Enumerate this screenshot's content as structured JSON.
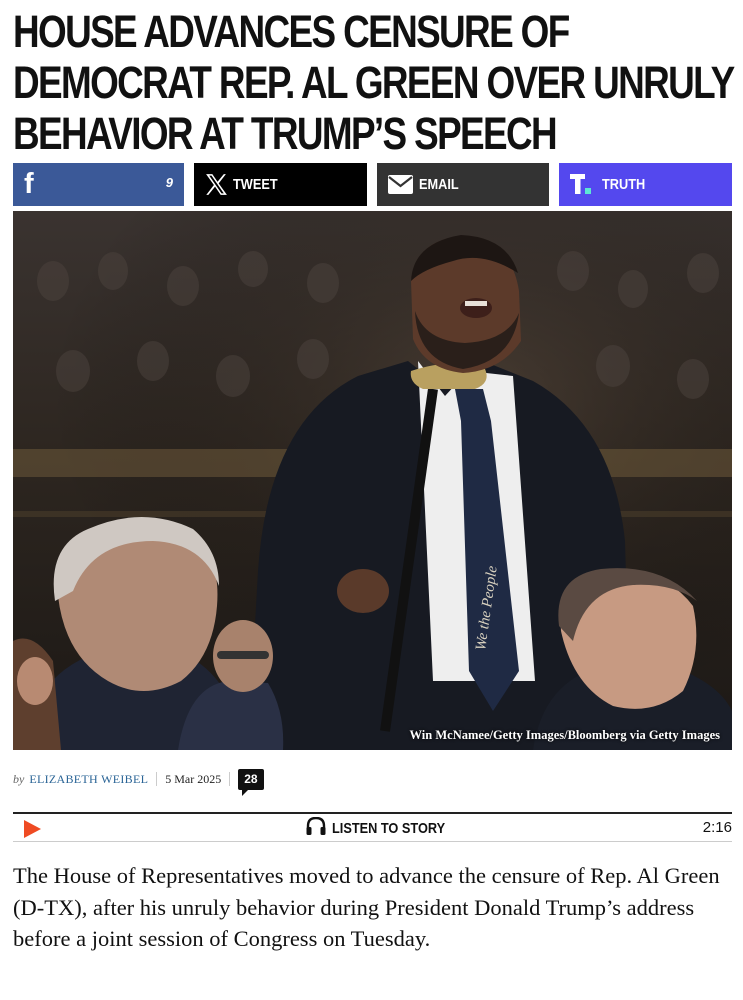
{
  "article": {
    "headline": "HOUSE ADVANCES CENSURE OF DEMOCRAT REP. AL GREEN OVER UNRULY BEHAVIOR AT TRUMP’S SPEECH",
    "share": {
      "facebook_count": "9",
      "tweet_label": "TWEET",
      "email_label": "EMAIL",
      "truth_label": "TRUTH",
      "colors": {
        "facebook": "#3b5998",
        "x": "#000000",
        "email": "#333333",
        "truth": "#5448ee"
      }
    },
    "photo": {
      "credit": "Win McNamee/Getty Images/Bloomberg via Getty Images",
      "tie_text": "We the People"
    },
    "byline": {
      "prefix": "by",
      "author": "ELIZABETH WEIBEL",
      "date": "5 Mar 2025",
      "comment_count": "28"
    },
    "listen": {
      "label": "LISTEN TO STORY",
      "duration": "2:16",
      "accent": "#ef4b23"
    },
    "lede": "The House of Representatives moved to advance the censure of Rep. Al Green (D-TX), after his unruly behavior during President Donald Trump’s address before a joint session of Congress on Tuesday."
  }
}
